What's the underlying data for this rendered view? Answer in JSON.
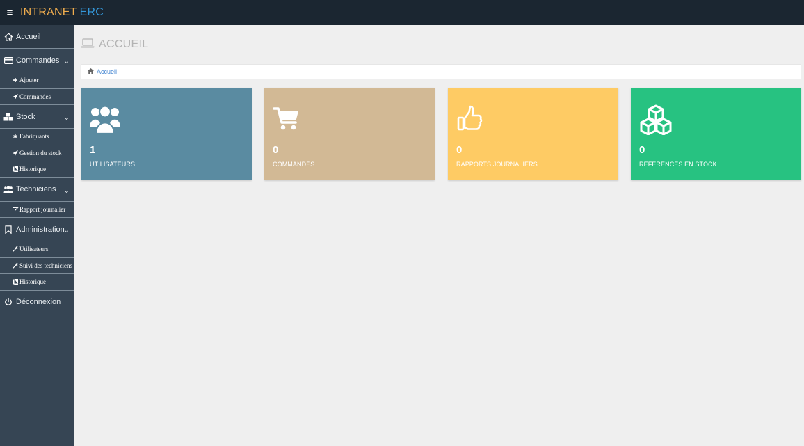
{
  "topbar": {
    "menu_icon": "hamburger-icon",
    "brand_part1": "INTRANET",
    "brand_part2": "ERC",
    "brand_color1": "#f0ad4e",
    "brand_color2": "#3498db"
  },
  "sidebar": {
    "accueil": {
      "label": "Accueil",
      "icon": "home-icon"
    },
    "commandes": {
      "label": "Commandes",
      "icon": "credit-card-icon",
      "items": [
        {
          "label": "Ajouter",
          "icon": "plus-icon"
        },
        {
          "label": "Commandes",
          "icon": "paper-plane-icon"
        }
      ]
    },
    "stock": {
      "label": "Stock",
      "icon": "cubes-icon",
      "items": [
        {
          "label": "Fabriquants",
          "icon": "asterisk-icon"
        },
        {
          "label": "Gestion du stock",
          "icon": "paper-plane-icon"
        },
        {
          "label": "Historique",
          "icon": "book-icon"
        }
      ]
    },
    "techniciens": {
      "label": "Techniciens",
      "icon": "users-icon",
      "items": [
        {
          "label": "Rapport journalier",
          "icon": "edit-icon"
        }
      ]
    },
    "administration": {
      "label": "Administration",
      "icon": "bookmark-icon",
      "items": [
        {
          "label": "Utilisateurs",
          "icon": "wrench-icon"
        },
        {
          "label": "Suivi des techniciens",
          "icon": "wrench-icon"
        },
        {
          "label": "Historique",
          "icon": "book-icon"
        }
      ]
    },
    "deconnexion": {
      "label": "Déconnexion",
      "icon": "power-icon"
    }
  },
  "main": {
    "title": "ACCUEIL",
    "title_icon": "laptop-icon",
    "breadcrumb": {
      "label": "Accueil",
      "icon": "home-icon"
    },
    "cards": [
      {
        "value": "1",
        "label": "UTILISATEURS",
        "color": "#5a8ba1",
        "icon": "users-icon"
      },
      {
        "value": "0",
        "label": "COMMANDES",
        "color": "#d2b995",
        "icon": "shopping-cart-icon"
      },
      {
        "value": "0",
        "label": "RAPPORTS JOURNALIERS",
        "color": "#fecb64",
        "icon": "thumbs-up-icon"
      },
      {
        "value": "0",
        "label": "RÉFÉRENCES EN STOCK",
        "color": "#27c281",
        "icon": "cubes-icon"
      }
    ]
  }
}
